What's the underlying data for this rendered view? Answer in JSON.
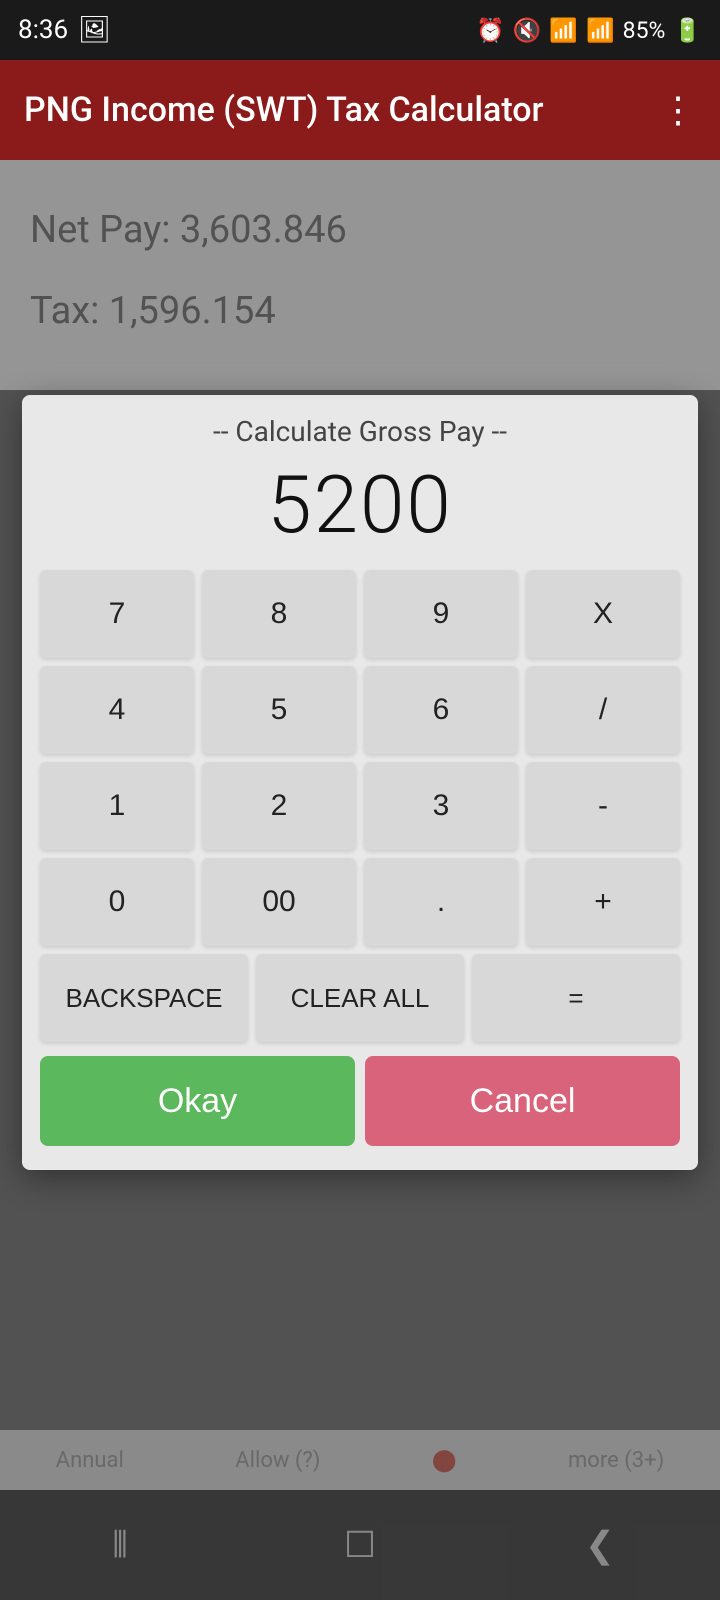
{
  "statusBar": {
    "time": "8:36",
    "battery": "85%"
  },
  "appBar": {
    "title": "PNG Income (SWT) Tax Calculator",
    "moreIcon": "⋮"
  },
  "bgContent": {
    "netPay": "Net Pay: 3,603.846",
    "tax": "Tax: 1,596.154"
  },
  "dialog": {
    "title": "-- Calculate Gross Pay --",
    "display": "5200",
    "buttons": {
      "row1": [
        "7",
        "8",
        "9",
        "X"
      ],
      "row2": [
        "4",
        "5",
        "6",
        "/"
      ],
      "row3": [
        "1",
        "2",
        "3",
        "-"
      ],
      "row4": [
        "0",
        "00",
        ".",
        "+"
      ],
      "bottomRow": [
        "BACKSPACE",
        "CLEAR ALL",
        "="
      ]
    },
    "okayLabel": "Okay",
    "cancelLabel": "Cancel"
  },
  "partialBar": {
    "items": [
      "Annual",
      "Allow (?)",
      "more (3+)"
    ]
  },
  "bottomNav": {
    "back": "❮",
    "home": "☐",
    "recent": "⫴"
  }
}
